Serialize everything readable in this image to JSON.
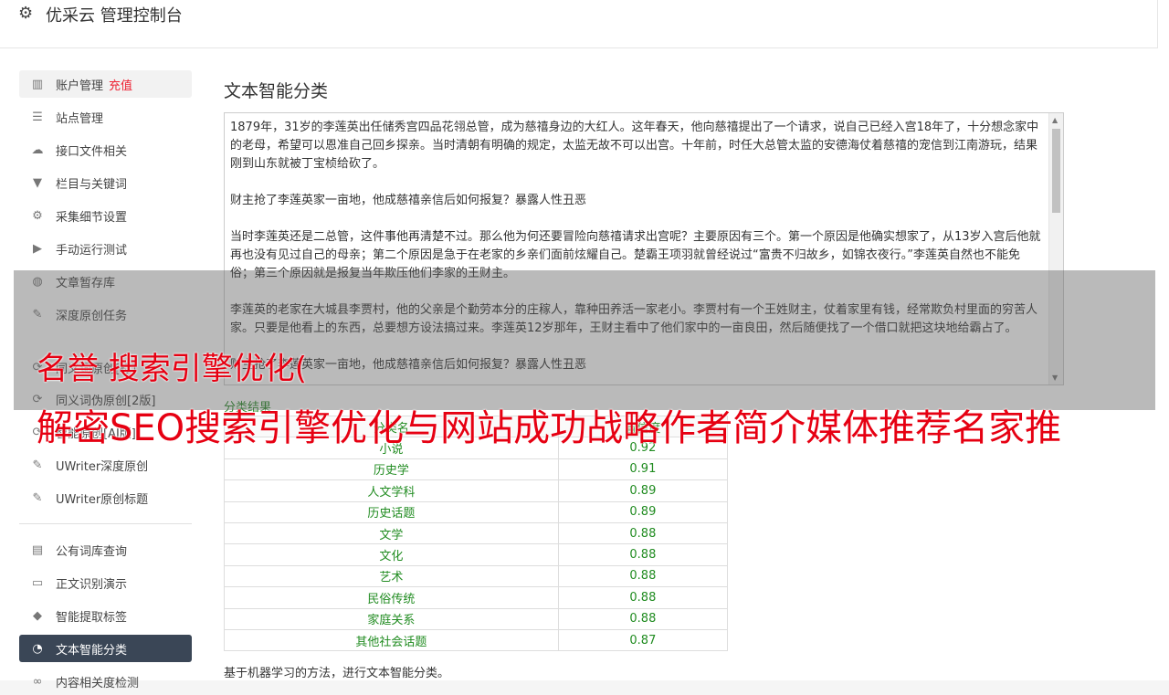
{
  "app": {
    "title": "优采云 管理控制台",
    "icon": "gear-icon"
  },
  "sidebar": {
    "items": [
      {
        "label": "账户管理",
        "extra": "充值",
        "icon": "bar-chart-icon"
      },
      {
        "label": "站点管理",
        "icon": "server-icon"
      },
      {
        "label": "接口文件相关",
        "icon": "cloud-upload-icon"
      },
      {
        "label": "栏目与关键词",
        "icon": "filter-icon"
      },
      {
        "label": "采集细节设置",
        "icon": "cogs-icon"
      },
      {
        "label": "手动运行测试",
        "icon": "play-circle-icon"
      },
      {
        "label": "文章暂存库",
        "icon": "database-icon"
      },
      {
        "label": "深度原创任务",
        "icon": "edit-icon"
      },
      {
        "label": "同义词原创[标]",
        "icon": "refresh-icon"
      },
      {
        "label": "同义词伪原创[2版]",
        "icon": "refresh-icon"
      },
      {
        "label": "智能原创[AI版]",
        "icon": "refresh-icon"
      },
      {
        "label": "UWriter深度原创",
        "icon": "edit-icon"
      },
      {
        "label": "UWriter原创标题",
        "icon": "edit-icon"
      },
      {
        "label": "公有词库查询",
        "icon": "book-icon"
      },
      {
        "label": "正文识别演示",
        "icon": "desktop-icon"
      },
      {
        "label": "智能提取标签",
        "icon": "tag-icon"
      },
      {
        "label": "文本智能分类",
        "icon": "pie-chart-icon"
      },
      {
        "label": "内容相关度检测",
        "icon": "link-icon"
      }
    ]
  },
  "main": {
    "heading": "文本智能分类",
    "text_paragraphs": [
      "1879年，31岁的李莲英出任储秀宫四品花翎总管，成为慈禧身边的大红人。这年春天，他向慈禧提出了一个请求，说自己已经入宫18年了，十分想念家中的老母，希望可以恩准自己回乡探亲。当时清朝有明确的规定，太监无故不可以出宫。十年前，时任大总管太监的安德海仗着慈禧的宠信到江南游玩，结果刚到山东就被丁宝桢给砍了。",
      "财主抢了李莲英家一亩地，他成慈禧亲信后如何报复？暴露人性丑恶",
      "当时李莲英还是二总管，这件事他再清楚不过。那么他为何还要冒险向慈禧请求出宫呢？主要原因有三个。第一个原因是他确实想家了，从13岁入宫后他就再也没有见过自己的母亲；第二个原因是急于在老家的乡亲们面前炫耀自己。楚霸王项羽就曾经说过“富贵不归故乡，如锦衣夜行。”李莲英自然也不能免俗；第三个原因就是报复当年欺压他们李家的王财主。",
      "李莲英的老家在大城县李贾村，他的父亲是个勤劳本分的庄稼人，靠种田养活一家老小。李贾村有一个王姓财主，仗着家里有钱，经常欺负村里面的穷苦人家。只要是他看上的东西，总要想方设法搞过来。李莲英12岁那年，王财主看中了他们家中的一亩良田，然后随便找了一个借口就把这块地给霸占了。",
      "财主抢了李莲英家一亩地，他成慈禧亲信后如何报复？暴露人性丑恶"
    ],
    "result_label": "分类结果",
    "table": {
      "headers": [
        "分类名",
        "置信度"
      ],
      "rows": [
        [
          "小说",
          "0.92"
        ],
        [
          "历史学",
          "0.91"
        ],
        [
          "人文学科",
          "0.89"
        ],
        [
          "历史话题",
          "0.89"
        ],
        [
          "文学",
          "0.88"
        ],
        [
          "文化",
          "0.88"
        ],
        [
          "艺术",
          "0.88"
        ],
        [
          "民俗传统",
          "0.88"
        ],
        [
          "家庭关系",
          "0.88"
        ],
        [
          "其他社会话题",
          "0.87"
        ]
      ]
    },
    "footnote": "基于机器学习的方法，进行文本智能分类。"
  },
  "overlay": {
    "line1": "名誉 搜索引擎优化(",
    "line2": "解密SEO搜索引擎优化与网站成功战略作者简介媒体推荐名家推"
  }
}
